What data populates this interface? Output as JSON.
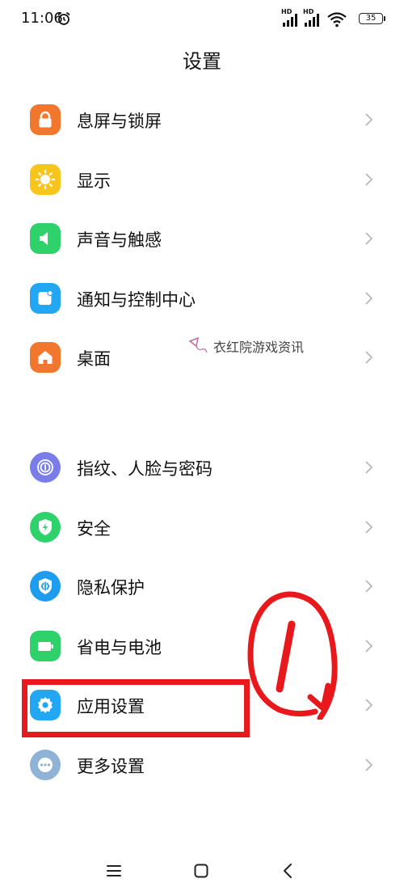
{
  "status_bar": {
    "time": "11:06",
    "hd_label_1": "HD",
    "hd_label_2": "HD",
    "battery": "35"
  },
  "page": {
    "title": "设置"
  },
  "group_1": [
    {
      "label": "息屏与锁屏",
      "icon": "lock-icon",
      "color": "#f2772e"
    },
    {
      "label": "显示",
      "icon": "sun-icon",
      "color": "#f8c51c"
    },
    {
      "label": "声音与触感",
      "icon": "speaker-icon",
      "color": "#2fd16b"
    },
    {
      "label": "通知与控制中心",
      "icon": "notification-icon",
      "color": "#24a7f2"
    },
    {
      "label": "桌面",
      "icon": "home-icon",
      "color": "#f2772e"
    }
  ],
  "group_2": [
    {
      "label": "指纹、人脸与密码",
      "icon": "fingerprint-icon",
      "color": "#7a7ce8"
    },
    {
      "label": "安全",
      "icon": "shield-icon",
      "color": "#2fd16b"
    },
    {
      "label": "隐私保护",
      "icon": "privacy-icon",
      "color": "#1e9cf0"
    },
    {
      "label": "省电与电池",
      "icon": "battery-icon",
      "color": "#2fd16b"
    },
    {
      "label": "应用设置",
      "icon": "gear-icon",
      "color": "#24a7f2"
    },
    {
      "label": "更多设置",
      "icon": "more-icon",
      "color": "#8fb3d6"
    }
  ],
  "watermark": {
    "text": "衣红院游戏资讯"
  },
  "annotation": {
    "color": "#e8191c"
  }
}
